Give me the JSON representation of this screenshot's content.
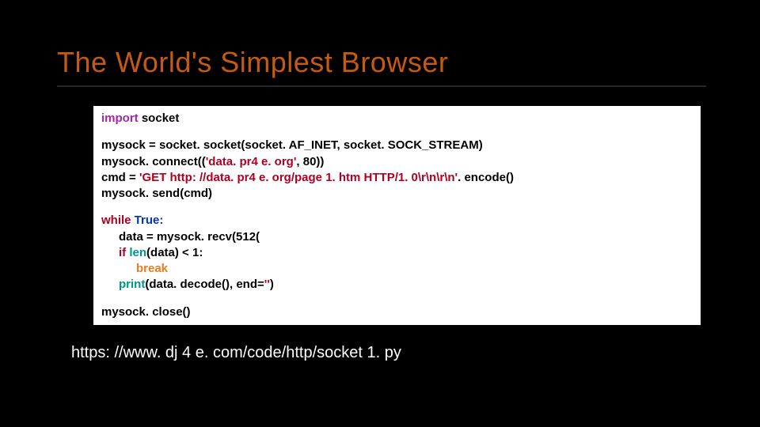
{
  "title": "The World's Simplest Browser",
  "code": {
    "s1": {
      "import": "import",
      "module": "socket"
    },
    "s2": {
      "l1": "mysock = socket. socket(socket. AF_INET, socket. SOCK_STREAM)",
      "l2a": "mysock. connect((",
      "l2str": "'data. pr4 e. org'",
      "l2b": ", ",
      "l2num": "80",
      "l2c": "))",
      "l3a": "cmd = ",
      "l3str": "'GET http: //data. pr4 e. org/page 1. htm HTTP/1. 0\\r\\n\\r\\n'",
      "l3b": ". encode()",
      "l4": "mysock. send(cmd)"
    },
    "s3": {
      "l1a": "while",
      "l1b": " True:",
      "l2a": "data = mysock. recv(",
      "l2num": "512",
      "l2b": "(",
      "l3a": "if ",
      "l3len": "len",
      "l3b": "(data) < ",
      "l3num": "1",
      "l3c": ":",
      "l4": "break",
      "l5a": "print",
      "l5b": "(data. decode(), end=",
      "l5str": "''",
      "l5c": ")"
    },
    "s4": {
      "l1": "mysock. close()"
    }
  },
  "link": "https: //www. dj 4 e. com/code/http/socket 1. py"
}
